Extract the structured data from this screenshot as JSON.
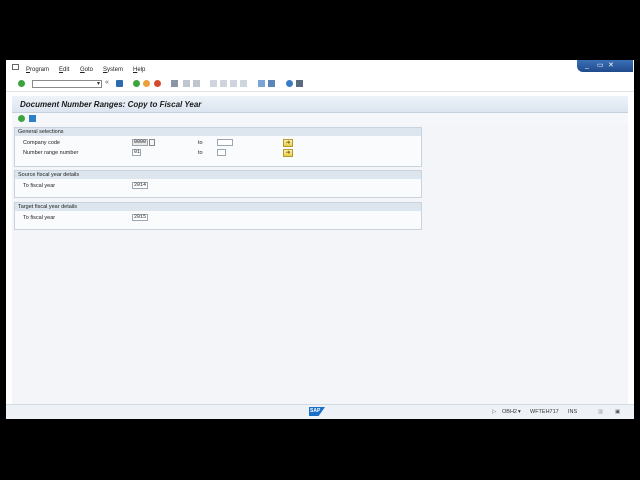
{
  "menu": {
    "items": [
      {
        "label": "Program"
      },
      {
        "label": "Edit"
      },
      {
        "label": "Goto"
      },
      {
        "label": "System"
      },
      {
        "label": "Help"
      }
    ]
  },
  "window_controls": {
    "minimize": "_",
    "maximize": "▭",
    "close": "✕"
  },
  "toolbar": {
    "command_field_value": "",
    "back_icon": "back-icon",
    "save_icon": "save-icon"
  },
  "page": {
    "title": "Document Number Ranges: Copy to Fiscal Year"
  },
  "general_selections": {
    "title": "General selections",
    "company_code_label": "Company code",
    "company_code_value": "0000",
    "company_code_to_label": "to",
    "company_code_to_value": "",
    "number_range_label": "Number range number",
    "number_range_value": "01",
    "number_range_to_label": "to",
    "number_range_to_value": ""
  },
  "source": {
    "title": "Source fiscal year details",
    "fiscal_year_label": "To fiscal year",
    "fiscal_year_value": "2014"
  },
  "target": {
    "title": "Target fiscal year details",
    "fiscal_year_label": "To fiscal year",
    "fiscal_year_value": "2015"
  },
  "status": {
    "logo": "SAP",
    "system": "OBH2",
    "server": "WFTEH717",
    "mode": "INS"
  },
  "colors": {
    "accent": "#1f4a8c",
    "title_bg": "#dbe5f0",
    "group_title_bg": "#dde6ef"
  }
}
